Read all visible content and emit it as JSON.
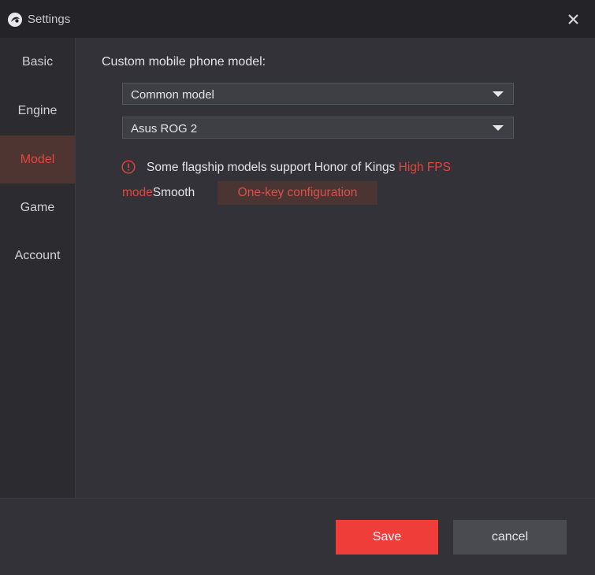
{
  "window": {
    "title": "Settings",
    "logo_icon": "app-logo-icon",
    "close_icon": "close-icon"
  },
  "sidebar": {
    "items": [
      {
        "label": "Basic",
        "active": false
      },
      {
        "label": "Engine",
        "active": false
      },
      {
        "label": "Model",
        "active": true
      },
      {
        "label": "Game",
        "active": false
      },
      {
        "label": "Account",
        "active": false
      }
    ]
  },
  "model": {
    "heading": "Custom mobile phone model:",
    "category_select": {
      "value": "Common model",
      "caret_icon": "caret-down-icon"
    },
    "device_select": {
      "value": "Asus ROG 2",
      "caret_icon": "caret-down-icon"
    },
    "notice": {
      "icon": "alert-circle-icon",
      "text_a": "Some flagship models support Honor of Kings",
      "text_b": "High FPS",
      "text_c": "mode",
      "text_d": "Smooth",
      "button_label": "One-key configuration"
    }
  },
  "footer": {
    "save_label": "Save",
    "cancel_label": "cancel"
  },
  "colors": {
    "accent": "#ef3e3a",
    "accent_text": "#e5453e",
    "background": "#323238",
    "titlebar": "#232328",
    "sidebar": "#2b2b30",
    "active_item_bg": "#4f3531"
  }
}
